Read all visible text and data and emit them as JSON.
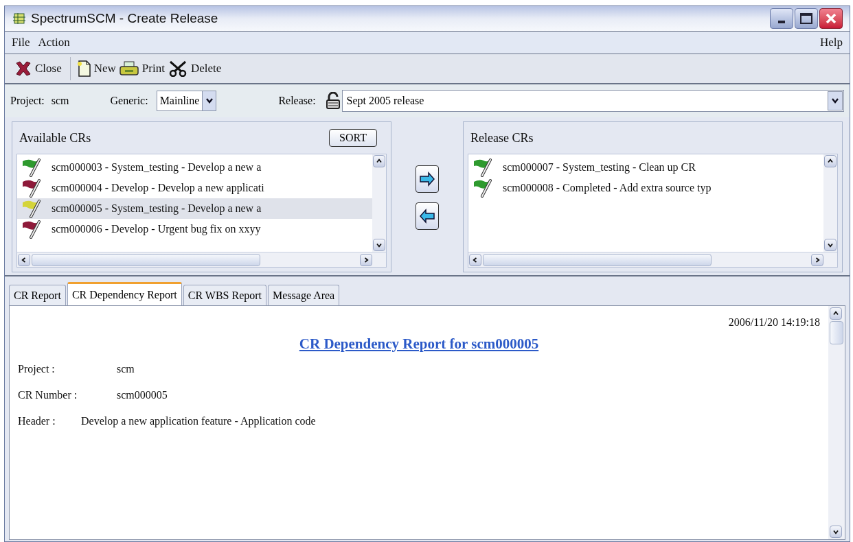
{
  "window": {
    "title": "SpectrumSCM - Create Release"
  },
  "menu": [
    {
      "label": "File"
    },
    {
      "label": "Action"
    }
  ],
  "help_menu": {
    "label": "Help"
  },
  "toolbar": [
    {
      "label": "Close",
      "kind": "close"
    },
    {
      "label": "New",
      "kind": "new"
    },
    {
      "label": "Print",
      "kind": "print"
    },
    {
      "label": "Delete",
      "kind": "delete"
    }
  ],
  "filters": {
    "project_label": "Project:",
    "project": "scm",
    "generic_label": "Generic:",
    "generic": "Mainline",
    "release_label": "Release:",
    "release": "Sept 2005 release"
  },
  "available": {
    "title": "Available CRs",
    "sort_button": "SORT",
    "items": [
      {
        "text": "scm000003 - System_testing - Develop a new a",
        "color": "#2e9a2e",
        "selected": false
      },
      {
        "text": "scm000004 - Develop - Develop a new applicati",
        "color": "#8e1a3a",
        "selected": false
      },
      {
        "text": "scm000005 - System_testing - Develop a new a",
        "color": "#d4d43a",
        "selected": true
      },
      {
        "text": "scm000006 - Develop - Urgent bug fix on xxyy",
        "color": "#8e1a3a",
        "selected": false
      }
    ]
  },
  "release": {
    "title": "Release CRs",
    "items": [
      {
        "text": "scm000007 - System_testing - Clean up CR",
        "color": "#2e9a2e",
        "selected": false
      },
      {
        "text": "scm000008 - Completed - Add extra source typ",
        "color": "#2e9a2e",
        "selected": false
      }
    ]
  },
  "tabs": [
    {
      "label": "CR Report",
      "selected": false
    },
    {
      "label": "CR Dependency Report",
      "selected": true
    },
    {
      "label": "CR WBS Report",
      "selected": false
    },
    {
      "label": "Message Area",
      "selected": false
    }
  ],
  "report": {
    "timestamp": "2006/11/20 14:19:18",
    "title": "CR Dependency Report for scm000005",
    "fields": [
      {
        "label": "Project :",
        "value": "scm"
      },
      {
        "label": "CR Number :",
        "value": "scm000005"
      },
      {
        "label": "Header :",
        "value": "Develop a new application feature - Application code"
      }
    ]
  }
}
